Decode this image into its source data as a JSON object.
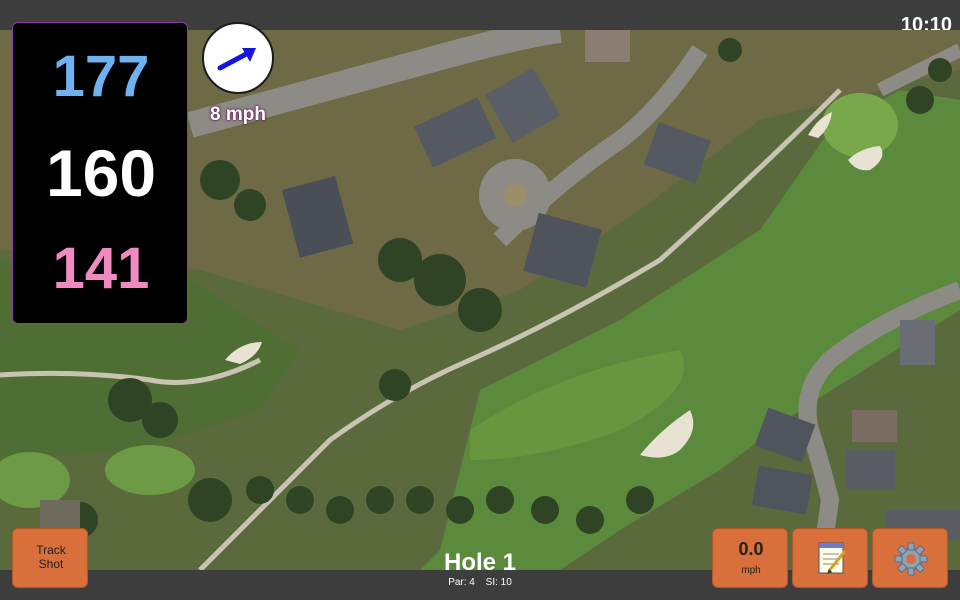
{
  "status_bar": {
    "time": "10:10"
  },
  "yardages": {
    "back": "177",
    "middle": "160",
    "front": "141",
    "colors": {
      "back": "#6fb2f2",
      "middle": "#ffffff",
      "front": "#f08ac0"
    }
  },
  "wind": {
    "speed_label": "8 mph",
    "direction_icon": "arrow-right-icon"
  },
  "hole": {
    "title": "Hole 1",
    "par_label": "Par: 4",
    "si_label": "SI: 10"
  },
  "buttons": {
    "track_shot_label": "Track\nShot",
    "speed_value": "0.0",
    "speed_unit": "mph",
    "notes_icon": "notepad-icon",
    "settings_icon": "gear-icon"
  },
  "colors": {
    "accent_button": "#d96f3a",
    "border_accent": "#8a3ea0"
  }
}
